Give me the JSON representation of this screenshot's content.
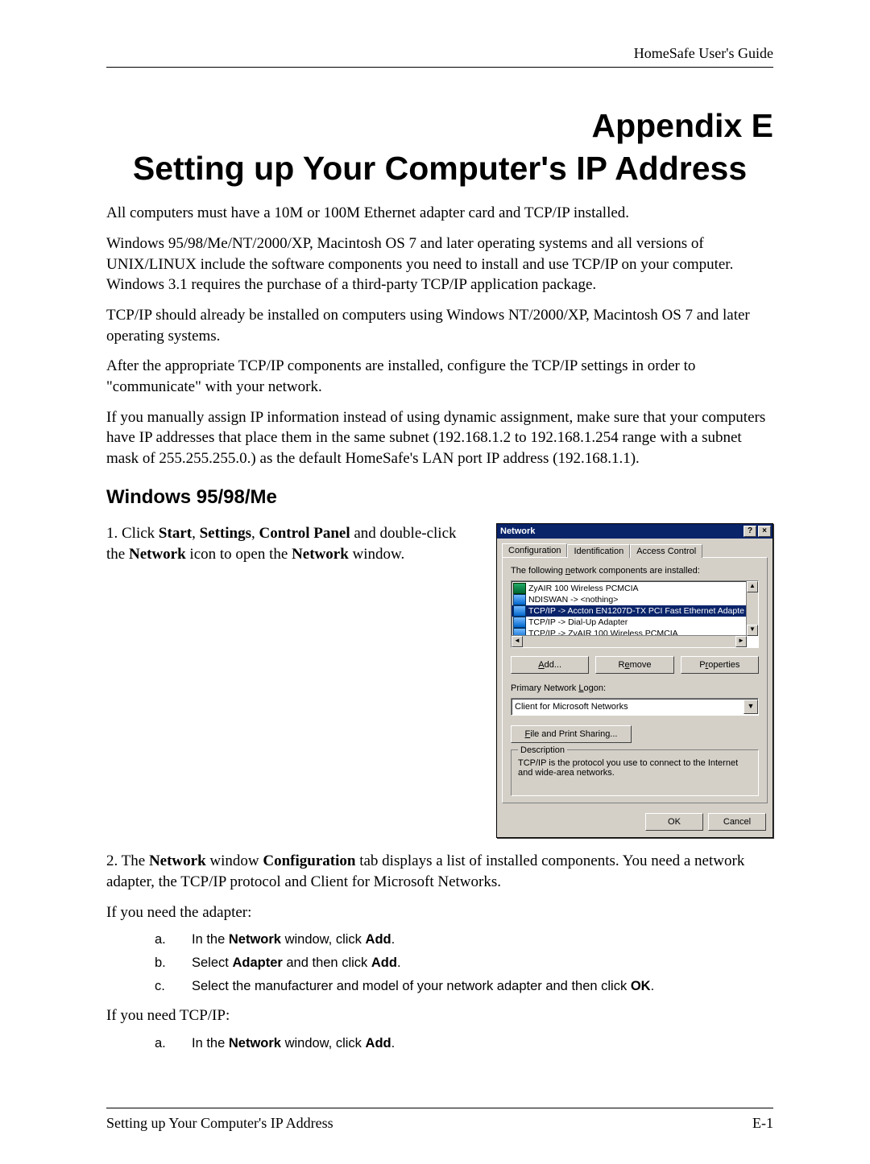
{
  "running_head": "HomeSafe User's Guide",
  "title_a": "Appendix E",
  "title_b": "Setting up Your Computer's IP Address",
  "paras": {
    "p1": "All computers must have a 10M or 100M Ethernet adapter card and TCP/IP installed.",
    "p2": "Windows 95/98/Me/NT/2000/XP, Macintosh OS 7 and later operating systems and all versions of UNIX/LINUX include the software components you need to install and use TCP/IP on your computer. Windows 3.1 requires the purchase of a third-party TCP/IP application package.",
    "p3": "TCP/IP should already be installed on computers using Windows NT/2000/XP, Macintosh OS 7 and later operating systems.",
    "p4": "After the appropriate TCP/IP components are installed, configure the TCP/IP settings in order to \"communicate\" with your network.",
    "p5": "If you manually assign IP information instead of using dynamic assignment, make sure that your computers have IP addresses that place them in the same subnet (192.168.1.2 to 192.168.1.254 range with a subnet mask of 255.255.255.0.) as the default HomeSafe's LAN port IP address (192.168.1.1)."
  },
  "section1": "Windows 95/98/Me",
  "step1_pre": "1. Click ",
  "step1_b1": "Start",
  "step1_s1": ", ",
  "step1_b2": "Settings",
  "step1_s2": ", ",
  "step1_b3": "Control Panel",
  "step1_s3": " and double-click the ",
  "step1_b4": "Network",
  "step1_s4": " icon to open the ",
  "step1_b5": "Network",
  "step1_s5": " window.",
  "dialog": {
    "title": "Network",
    "help": "?",
    "close": "×",
    "tabs": [
      "Configuration",
      "Identification",
      "Access Control"
    ],
    "list_label": "The following network components are installed:",
    "items": [
      {
        "ico": "card",
        "text": "ZyAIR 100 Wireless PCMCIA"
      },
      {
        "ico": "proto",
        "text": "NDISWAN -> <nothing>"
      },
      {
        "ico": "proto",
        "text": "TCP/IP -> Accton EN1207D-TX PCI Fast Ethernet Adapte",
        "sel": true
      },
      {
        "ico": "proto",
        "text": "TCP/IP -> Dial-Up Adapter"
      },
      {
        "ico": "proto",
        "text": "TCP/IP -> ZyAIR 100 Wireless PCMCIA"
      }
    ],
    "btn_add": "Add...",
    "btn_remove": "Remove",
    "btn_props": "Properties",
    "logon_label": "Primary Network Logon:",
    "logon_value": "Client for Microsoft Networks",
    "btn_share": "File and Print Sharing...",
    "desc_legend": "Description",
    "desc_text": "TCP/IP is the protocol you use to connect to the Internet and wide-area networks.",
    "ok": "OK",
    "cancel": "Cancel"
  },
  "step2_pre": "2. The ",
  "step2_b1": "Network",
  "step2_s1": " window ",
  "step2_b2": "Configuration",
  "step2_s2": " tab displays a list of installed components. You need a network adapter, the TCP/IP protocol and Client for Microsoft Networks.",
  "need_adapter": "If you need the adapter:",
  "adapter_steps": {
    "a_pre": "In the ",
    "a_b1": "Network",
    "a_mid": " window, click ",
    "a_b2": "Add",
    "a_post": ".",
    "b_pre": "Select ",
    "b_b1": "Adapter",
    "b_mid": " and then click ",
    "b_b2": "Add",
    "b_post": ".",
    "c_pre": "Select the manufacturer and model of your network adapter and then click ",
    "c_b1": "OK",
    "c_post": "."
  },
  "need_tcpip": "If you need TCP/IP:",
  "tcpip_steps": {
    "a_pre": "In the ",
    "a_b1": "Network",
    "a_mid": " window, click ",
    "a_b2": "Add",
    "a_post": "."
  },
  "footer_left": "Setting up Your Computer's IP Address",
  "footer_right": "E-1"
}
